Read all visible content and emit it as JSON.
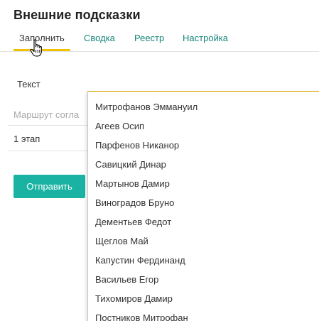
{
  "page": {
    "title": "Внешние подсказки"
  },
  "tabs": [
    {
      "label": "Заполнить",
      "active": true
    },
    {
      "label": "Сводка",
      "active": false
    },
    {
      "label": "Реестр",
      "active": false
    },
    {
      "label": "Настройка",
      "active": false
    }
  ],
  "form": {
    "text_label": "Текст",
    "route_placeholder": "Маршрут согла",
    "stage_value": "1 этап",
    "submit_label": "Отправить"
  },
  "dropdown": {
    "items": [
      "Митрофанов Эммануил",
      "Агеев Осип",
      "Парфенов Никанор",
      "Савицкий Динар",
      "Мартынов Дамир",
      "Виноградов Бруно",
      "Дементьев Федот",
      "Щеглов Май",
      "Капустин Фердинанд",
      "Васильев Егор",
      "Тихомиров Дамир",
      "Постников Митрофан"
    ]
  },
  "colors": {
    "accent": "#1ab3a3",
    "tab_link": "#16857a",
    "active_underline": "#f2c200",
    "placeholder": "#a8a8a8"
  },
  "icons": {
    "cursor": "hand-pointer-icon"
  }
}
